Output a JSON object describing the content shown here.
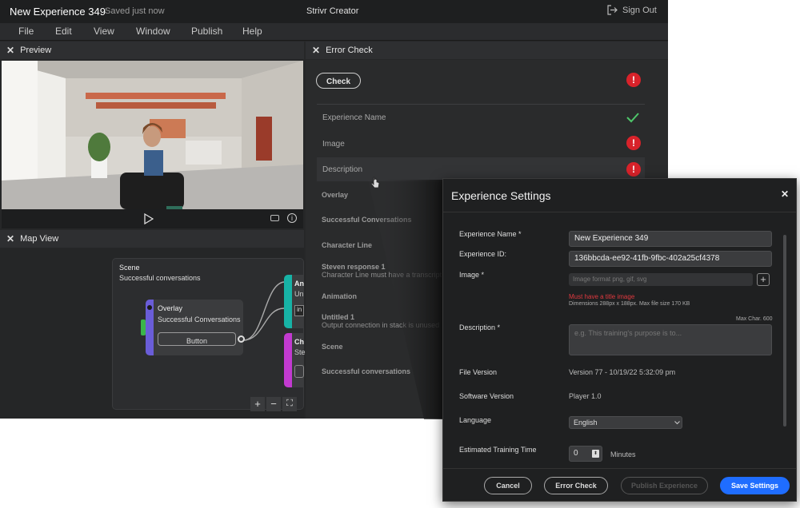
{
  "titlebar": {
    "doc_title": "New Experience 349",
    "save_status": "Saved just now",
    "app_name": "Strivr Creator",
    "sign_out_label": "Sign Out"
  },
  "menu": [
    "File",
    "Edit",
    "View",
    "Window",
    "Publish",
    "Help"
  ],
  "preview": {
    "title": "Preview"
  },
  "map_view": {
    "title": "Map View",
    "scene_label": "Scene",
    "scene_name": "Successful conversations",
    "overlay_node": {
      "title": "Overlay",
      "subtitle": "Successful Conversations",
      "button_label": "Button"
    },
    "anim_node": {
      "title": "An",
      "sub": "Un",
      "chip": "in"
    },
    "char_node": {
      "title": "Ch",
      "sub": "Ste"
    }
  },
  "error_check": {
    "title": "Error Check",
    "check_button": "Check",
    "rows": [
      "Experience Name",
      "Image",
      "Description"
    ],
    "overlay_section": "Overlay",
    "overlay_item": "Successful Conversations",
    "character_section": "Character Line",
    "character_item_title": "Steven response 1",
    "character_item_msg": "Character Line must have a transcript",
    "animation_section": "Animation",
    "animation_item_title": "Untitled 1",
    "animation_item_msg": "Output connection in stack is unused",
    "scene_section": "Scene",
    "scene_item": "Successful conversations"
  },
  "dialog": {
    "title": "Experience Settings",
    "name_label": "Experience Name *",
    "name_value": "New Experience 349",
    "id_label": "Experience ID:",
    "id_value": "136bbcda-ee92-41fb-9fbc-402a25cf4378",
    "image_label": "Image *",
    "image_placeholder": "Image format png, gif, svg",
    "image_error": "Must have a title image",
    "image_hint": "Dimensions 288px x 188px. Max file size 170 KB",
    "desc_label": "Description *",
    "desc_max": "Max Char. 600",
    "desc_placeholder": "e.g. This training's purpose is to...",
    "file_version_label": "File Version",
    "file_version_value": "Version 77 - 10/19/22 5:32:09 pm",
    "software_version_label": "Software Version",
    "software_version_value": "Player 1.0",
    "language_label": "Language",
    "language_value": "English",
    "time_label": "Estimated Training Time",
    "time_value": "0",
    "time_unit": "Minutes",
    "buttons": {
      "cancel": "Cancel",
      "error_check": "Error Check",
      "publish": "Publish Experience",
      "save": "Save Settings"
    }
  },
  "colors": {
    "accent": "#1f6dff",
    "error": "#d8222a",
    "ok": "#4ec66a",
    "overlay_node": "#6a5dd8",
    "anim_node": "#17b3a6",
    "char_node": "#c23ad0"
  }
}
